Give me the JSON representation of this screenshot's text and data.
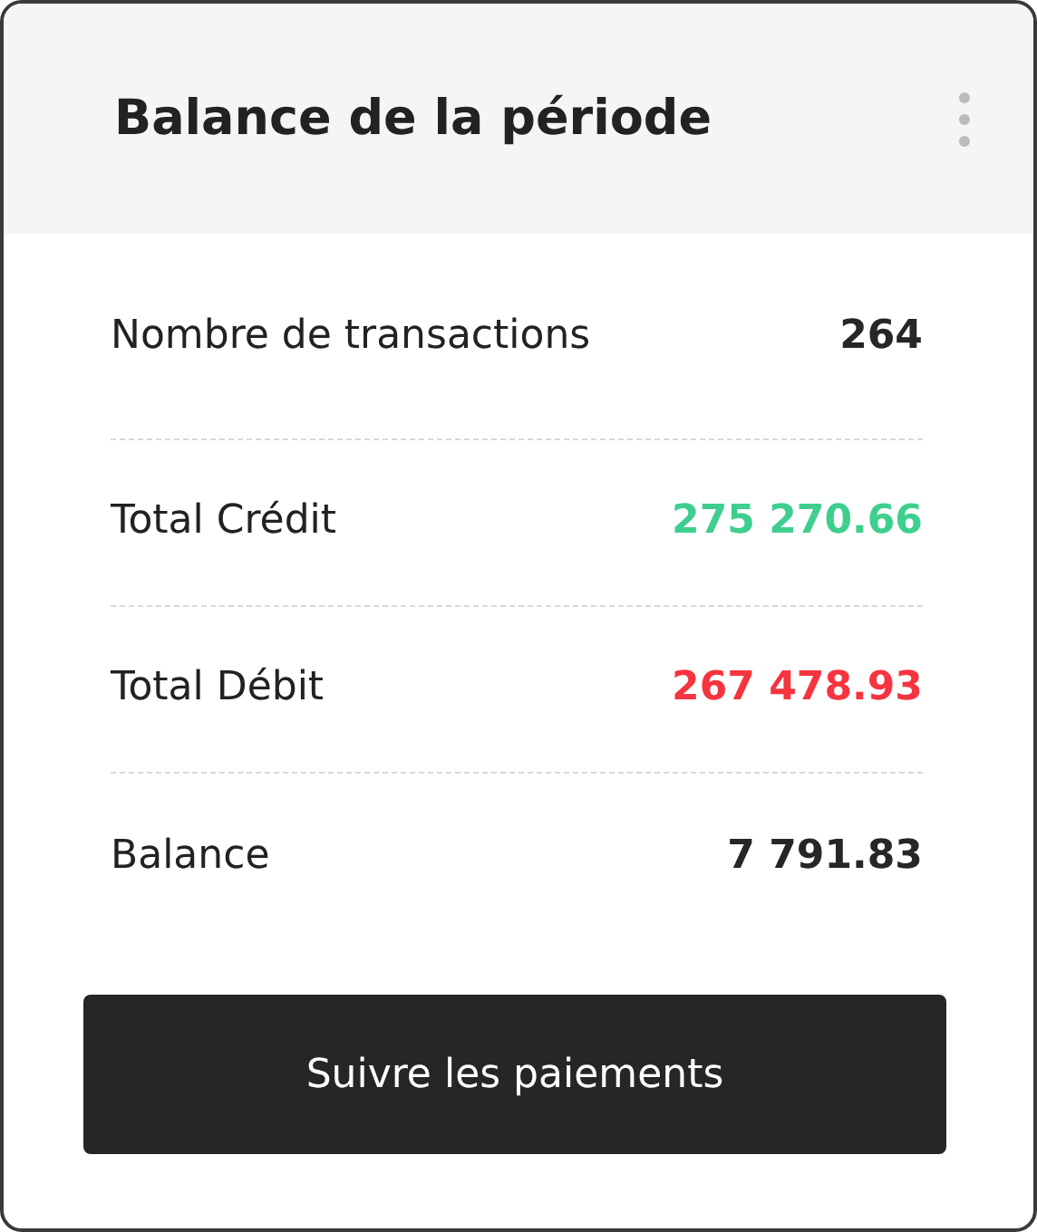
{
  "card": {
    "title": "Balance de la période"
  },
  "rows": [
    {
      "label": "Nombre de transactions",
      "value": "264",
      "kind": "neutral"
    },
    {
      "label": "Total Crédit",
      "value": "275 270.66",
      "kind": "credit"
    },
    {
      "label": "Total Débit",
      "value": "267 478.93",
      "kind": "debit"
    },
    {
      "label": "Balance",
      "value": "7 791.83",
      "kind": "neutral"
    }
  ],
  "button": {
    "label": "Suivre les paiements"
  }
}
